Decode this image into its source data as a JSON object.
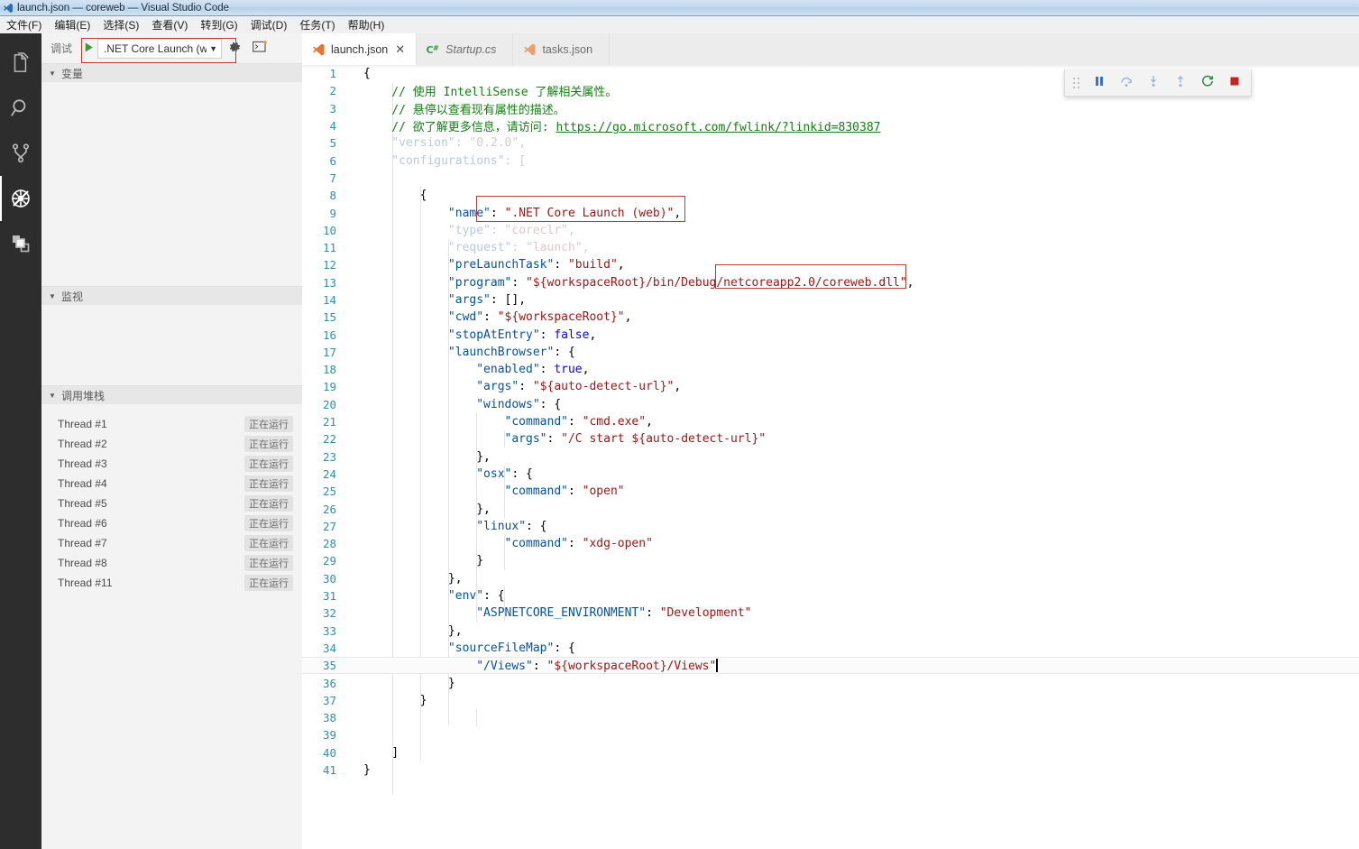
{
  "window": {
    "title": "launch.json — coreweb — Visual Studio Code",
    "app_icon": "vscode-icon"
  },
  "menubar": {
    "items": [
      {
        "label": "文件(F)",
        "name": "menu-file"
      },
      {
        "label": "编辑(E)",
        "name": "menu-edit"
      },
      {
        "label": "选择(S)",
        "name": "menu-selection"
      },
      {
        "label": "查看(V)",
        "name": "menu-view"
      },
      {
        "label": "转到(G)",
        "name": "menu-go"
      },
      {
        "label": "调试(D)",
        "name": "menu-debug"
      },
      {
        "label": "任务(T)",
        "name": "menu-tasks"
      },
      {
        "label": "帮助(H)",
        "name": "menu-help"
      }
    ]
  },
  "activitybar": {
    "items": [
      {
        "name": "explorer",
        "icon": "files-icon",
        "active": false
      },
      {
        "name": "search",
        "icon": "search-icon",
        "active": false
      },
      {
        "name": "source-control",
        "icon": "source-control-icon",
        "active": false
      },
      {
        "name": "debug",
        "icon": "debug-icon",
        "active": true
      },
      {
        "name": "extensions",
        "icon": "extensions-icon",
        "active": false
      }
    ]
  },
  "sidebar": {
    "toolbar": {
      "label": "调试",
      "run_icon": "play-icon",
      "config_value": ".NET Core Launch (we",
      "config_arrow": "▼",
      "settings_icon": "gear-icon",
      "console_icon": "open-debug-console-icon"
    },
    "sections": [
      {
        "name": "variables",
        "title": "变量",
        "twisty": "▼"
      },
      {
        "name": "watch",
        "title": "监视",
        "twisty": "▼"
      },
      {
        "name": "callstack",
        "title": "调用堆栈",
        "twisty": "▼"
      }
    ],
    "threads": [
      {
        "name": "Thread #1",
        "state": "正在运行"
      },
      {
        "name": "Thread #2",
        "state": "正在运行"
      },
      {
        "name": "Thread #3",
        "state": "正在运行"
      },
      {
        "name": "Thread #4",
        "state": "正在运行"
      },
      {
        "name": "Thread #5",
        "state": "正在运行"
      },
      {
        "name": "Thread #6",
        "state": "正在运行"
      },
      {
        "name": "Thread #7",
        "state": "正在运行"
      },
      {
        "name": "Thread #8",
        "state": "正在运行"
      },
      {
        "name": "Thread #11",
        "state": "正在运行"
      }
    ]
  },
  "tabs": [
    {
      "label": "launch.json",
      "icon": "json-vscode-icon",
      "active": true,
      "italic": false,
      "close": "✕"
    },
    {
      "label": "Startup.cs",
      "icon": "csharp-icon",
      "active": false,
      "italic": true,
      "close": ""
    },
    {
      "label": "tasks.json",
      "icon": "json-vscode-icon",
      "active": false,
      "italic": false,
      "close": ""
    }
  ],
  "debug_toolbar": {
    "buttons": [
      {
        "name": "drag-handle",
        "icon": "grip-dots-icon",
        "title": ""
      },
      {
        "name": "pause-button",
        "icon": "pause-icon",
        "title": ""
      },
      {
        "name": "step-over-button",
        "icon": "step-over-icon",
        "title": ""
      },
      {
        "name": "step-into-button",
        "icon": "step-into-icon",
        "title": ""
      },
      {
        "name": "step-out-button",
        "icon": "step-out-icon",
        "title": ""
      },
      {
        "name": "restart-button",
        "icon": "restart-icon",
        "title": ""
      },
      {
        "name": "stop-button",
        "icon": "stop-icon",
        "title": ""
      }
    ]
  },
  "editor": {
    "filename": "launch.json",
    "current_line": 35,
    "total_lines": 41,
    "lines": [
      {
        "n": 1,
        "text": "{"
      },
      {
        "n": 2,
        "text": "    // 使用 IntelliSense 了解相关属性。"
      },
      {
        "n": 3,
        "text": "    // 悬停以查看现有属性的描述。"
      },
      {
        "n": 4,
        "text": "    // 欲了解更多信息，请访问: https://go.microsoft.com/fwlink/?linkid=830387"
      },
      {
        "n": 5,
        "text": "    \"version\": \"0.2.0\","
      },
      {
        "n": 6,
        "text": "    \"configurations\": ["
      },
      {
        "n": 7,
        "text": ""
      },
      {
        "n": 8,
        "text": "        {"
      },
      {
        "n": 9,
        "text": "            \"name\": \".NET Core Launch (web)\","
      },
      {
        "n": 10,
        "text": "            \"type\": \"coreclr\","
      },
      {
        "n": 11,
        "text": "            \"request\": \"launch\","
      },
      {
        "n": 12,
        "text": "            \"preLaunchTask\": \"build\","
      },
      {
        "n": 13,
        "text": "            \"program\": \"${workspaceRoot}/bin/Debug/netcoreapp2.0/coreweb.dll\","
      },
      {
        "n": 14,
        "text": "            \"args\": [],"
      },
      {
        "n": 15,
        "text": "            \"cwd\": \"${workspaceRoot}\","
      },
      {
        "n": 16,
        "text": "            \"stopAtEntry\": false,"
      },
      {
        "n": 17,
        "text": "            \"launchBrowser\": {"
      },
      {
        "n": 18,
        "text": "                \"enabled\": true,"
      },
      {
        "n": 19,
        "text": "                \"args\": \"${auto-detect-url}\","
      },
      {
        "n": 20,
        "text": "                \"windows\": {"
      },
      {
        "n": 21,
        "text": "                    \"command\": \"cmd.exe\","
      },
      {
        "n": 22,
        "text": "                    \"args\": \"/C start ${auto-detect-url}\""
      },
      {
        "n": 23,
        "text": "                },"
      },
      {
        "n": 24,
        "text": "                \"osx\": {"
      },
      {
        "n": 25,
        "text": "                    \"command\": \"open\""
      },
      {
        "n": 26,
        "text": "                },"
      },
      {
        "n": 27,
        "text": "                \"linux\": {"
      },
      {
        "n": 28,
        "text": "                    \"command\": \"xdg-open\""
      },
      {
        "n": 29,
        "text": "                }"
      },
      {
        "n": 30,
        "text": "            },"
      },
      {
        "n": 31,
        "text": "            \"env\": {"
      },
      {
        "n": 32,
        "text": "                \"ASPNETCORE_ENVIRONMENT\": \"Development\""
      },
      {
        "n": 33,
        "text": "            },"
      },
      {
        "n": 34,
        "text": "            \"sourceFileMap\": {"
      },
      {
        "n": 35,
        "text": "                \"/Views\": \"${workspaceRoot}/Views\""
      },
      {
        "n": 36,
        "text": "            }"
      },
      {
        "n": 37,
        "text": "        }"
      },
      {
        "n": 38,
        "text": ""
      },
      {
        "n": 39,
        "text": ""
      },
      {
        "n": 40,
        "text": "    ]"
      },
      {
        "n": 41,
        "text": "}"
      }
    ],
    "link_url": "https://go.microsoft.com/fwlink/?linkid=830387"
  },
  "annotations": [
    {
      "name": "annotation-config-dropdown",
      "target": "debug configuration selector"
    },
    {
      "name": "annotation-launch-name",
      "target": "\".NET Core Launch (web)\""
    },
    {
      "name": "annotation-program-path",
      "target": "netcoreapp2.0/coreweb.dll"
    }
  ],
  "colors": {
    "accent_red": "#c0392b",
    "activity_bar": "#2d2d2d",
    "sidebar_bg": "#f3f3f3",
    "tabbar_bg": "#ececec",
    "editor_bg": "#ffffff",
    "linenumber": "#2b91af",
    "comment": "#108010",
    "key": "#0451a5",
    "string": "#a31515",
    "number": "#098658",
    "boolean": "#0000ff"
  }
}
